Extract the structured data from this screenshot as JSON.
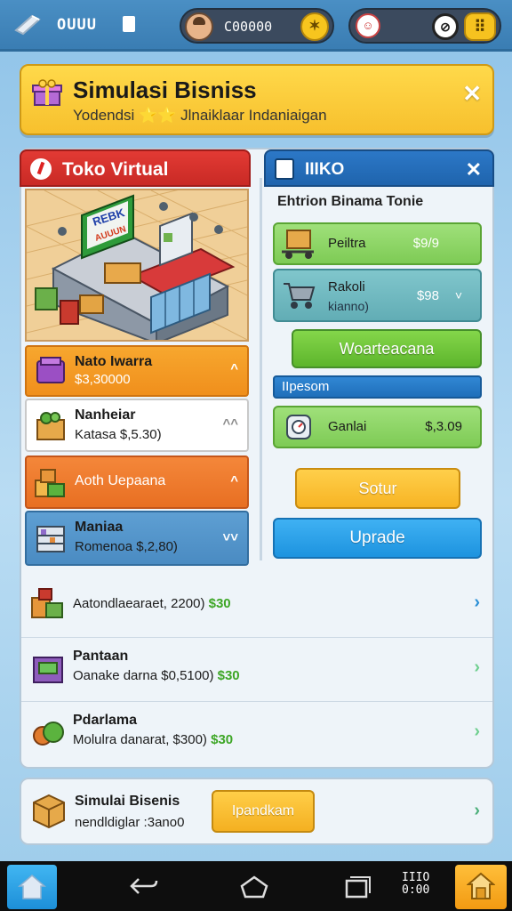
{
  "topbar": {
    "left_text": "OUUU",
    "coins_text": "C00000",
    "coin_glyph": "✶",
    "clock_glyph": "⊘",
    "grid_glyph": "⠿"
  },
  "banner": {
    "title": "Simulasi Bisniss",
    "subtitle": "Yodendsi ⭐⭐ Jlnaiklaar Indaniaigan",
    "close": "✕"
  },
  "left": {
    "header": "Toko Virtual",
    "scene_sign_line1": "REBK",
    "scene_sign_line2": "AUUUN",
    "cards": [
      {
        "name": "Nato Iwarra",
        "sub": "$3,30000",
        "chev": "^"
      },
      {
        "name": "Nanheiar",
        "sub": "Katasa        $,5.30)",
        "chev": "^^"
      },
      {
        "name": "Aoth Uepaana",
        "sub": "",
        "chev": "^"
      },
      {
        "name": "Maniaa",
        "sub": "Romenoa    $,2,80)",
        "chev": "˅˅"
      }
    ]
  },
  "right": {
    "header": "IIIKO",
    "close": "✕",
    "subtitle": "Ehtrion Binama Tonie",
    "items": [
      {
        "name": "Peiltra",
        "price": "$9/9",
        "chev": ""
      },
      {
        "name": "Rakoli",
        "sub": "kianno)",
        "price": "$98",
        "chev": "˅"
      }
    ],
    "green_button": "Woarteacana",
    "section_label": "IIpesom",
    "item3": {
      "name": "Ganlai",
      "price": "$,3.09"
    },
    "yellow_button": "Sotur",
    "blue_button": "Uprade"
  },
  "list": [
    {
      "name": "",
      "desc": "Aatondlaearaet, 2200)",
      "value": "$30",
      "chev": "›"
    },
    {
      "name": "Pantaan",
      "desc": "Oanake darna $0,5100)",
      "value": "$30",
      "chev": "›"
    },
    {
      "name": "Pdarlama",
      "desc": "Molulra danarat, $300)",
      "value": "$30",
      "chev": "›"
    }
  ],
  "bottom": {
    "title": "Simulai Bisenis",
    "sub": "nendldiglar :3ano0",
    "button": "Ipandkam",
    "chev": "›"
  },
  "nav": {
    "clock_top": "IIIO",
    "clock_bottom": "0:00"
  },
  "colors": {
    "banner": "#f7c02d",
    "left_header": "#d22f2a",
    "right_header": "#2270bb",
    "accent_green": "#3da626",
    "accent_blue": "#1d93df"
  }
}
